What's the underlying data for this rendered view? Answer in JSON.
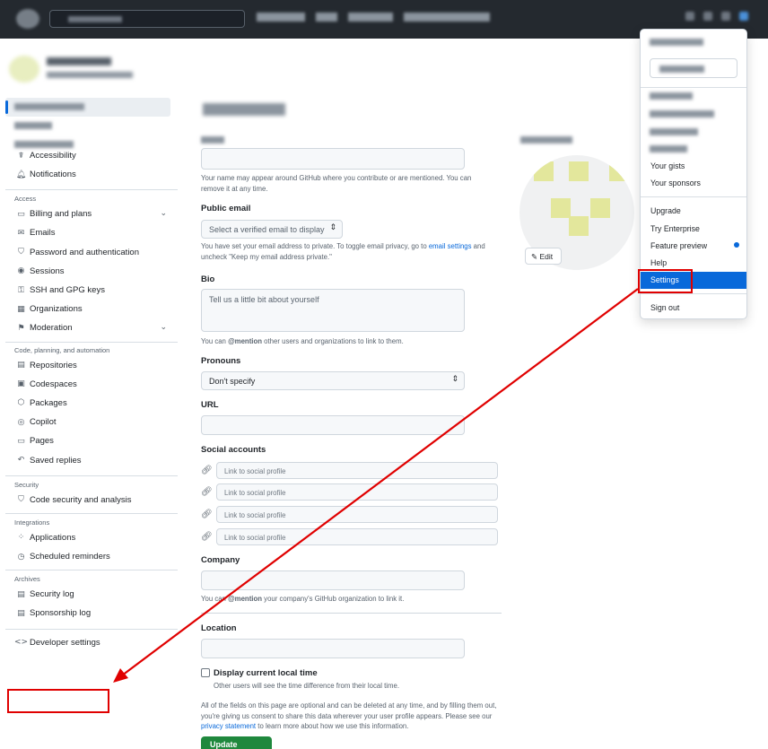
{
  "sidebar": {
    "items_top": [
      {
        "label": "Accessibility",
        "icon": "accessibility-icon"
      },
      {
        "label": "Notifications",
        "icon": "bell-icon"
      }
    ],
    "access": {
      "heading": "Access",
      "items": [
        {
          "label": "Billing and plans",
          "icon": "credit-card-icon",
          "chevron": true
        },
        {
          "label": "Emails",
          "icon": "mail-icon"
        },
        {
          "label": "Password and authentication",
          "icon": "shield-lock-icon"
        },
        {
          "label": "Sessions",
          "icon": "broadcast-icon"
        },
        {
          "label": "SSH and GPG keys",
          "icon": "key-icon"
        },
        {
          "label": "Organizations",
          "icon": "organization-icon"
        },
        {
          "label": "Moderation",
          "icon": "report-icon",
          "chevron": true
        }
      ]
    },
    "code": {
      "heading": "Code, planning, and automation",
      "items": [
        {
          "label": "Repositories",
          "icon": "repo-icon"
        },
        {
          "label": "Codespaces",
          "icon": "codespaces-icon"
        },
        {
          "label": "Packages",
          "icon": "package-icon"
        },
        {
          "label": "Copilot",
          "icon": "copilot-icon"
        },
        {
          "label": "Pages",
          "icon": "browser-icon"
        },
        {
          "label": "Saved replies",
          "icon": "reply-icon"
        }
      ]
    },
    "security": {
      "heading": "Security",
      "items": [
        {
          "label": "Code security and analysis",
          "icon": "shield-icon"
        }
      ]
    },
    "integrations": {
      "heading": "Integrations",
      "items": [
        {
          "label": "Applications",
          "icon": "apps-icon"
        },
        {
          "label": "Scheduled reminders",
          "icon": "clock-icon"
        }
      ]
    },
    "archives": {
      "heading": "Archives",
      "items": [
        {
          "label": "Security log",
          "icon": "log-icon"
        },
        {
          "label": "Sponsorship log",
          "icon": "log-icon"
        }
      ]
    },
    "developer": {
      "label": "Developer settings",
      "icon": "code-icon"
    }
  },
  "form": {
    "name_note": "Your name may appear around GitHub where you contribute or are mentioned. You can remove it at any time.",
    "public_email": {
      "label": "Public email",
      "value": "Select a verified email to display",
      "note_pre": "You have set your email address to private. To toggle email privacy, go to ",
      "note_link": "email settings",
      "note_post": " and uncheck \"Keep my email address private.\""
    },
    "bio": {
      "label": "Bio",
      "placeholder": "Tell us a little bit about yourself",
      "note_pre": "You can ",
      "note_bold": "@mention",
      "note_post": " other users and organizations to link to them."
    },
    "pronouns": {
      "label": "Pronouns",
      "value": "Don't specify"
    },
    "url": {
      "label": "URL"
    },
    "social": {
      "label": "Social accounts",
      "placeholders": [
        "Link to social profile",
        "Link to social profile",
        "Link to social profile",
        "Link to social profile"
      ]
    },
    "company": {
      "label": "Company",
      "note_pre": "You can ",
      "note_bold": "@mention",
      "note_post": " your company's GitHub organization to link it."
    },
    "location": {
      "label": "Location"
    },
    "local_time": {
      "label": "Display current local time",
      "note": "Other users will see the time difference from their local time."
    },
    "footer_pre": "All of the fields on this page are optional and can be deleted at any time, and by filling them out, you're giving us consent to share this data wherever your user profile appears. Please see our ",
    "footer_link": "privacy statement",
    "footer_post": " to learn more about how we use this information.",
    "update_button": "Update profile"
  },
  "avatar": {
    "edit_label": "Edit"
  },
  "dropdown": {
    "items": [
      {
        "label": "Your gists"
      },
      {
        "label": "Your sponsors"
      },
      {
        "label": "Upgrade"
      },
      {
        "label": "Try Enterprise"
      },
      {
        "label": "Feature preview"
      },
      {
        "label": "Help"
      },
      {
        "label": "Settings"
      },
      {
        "label": "Sign out"
      }
    ]
  },
  "colors": {
    "topbar": "#24292f",
    "accent": "#0969da",
    "primary_button": "#1f883d",
    "annotation": "#e00000",
    "avatar_fill": "#e3e79c"
  }
}
